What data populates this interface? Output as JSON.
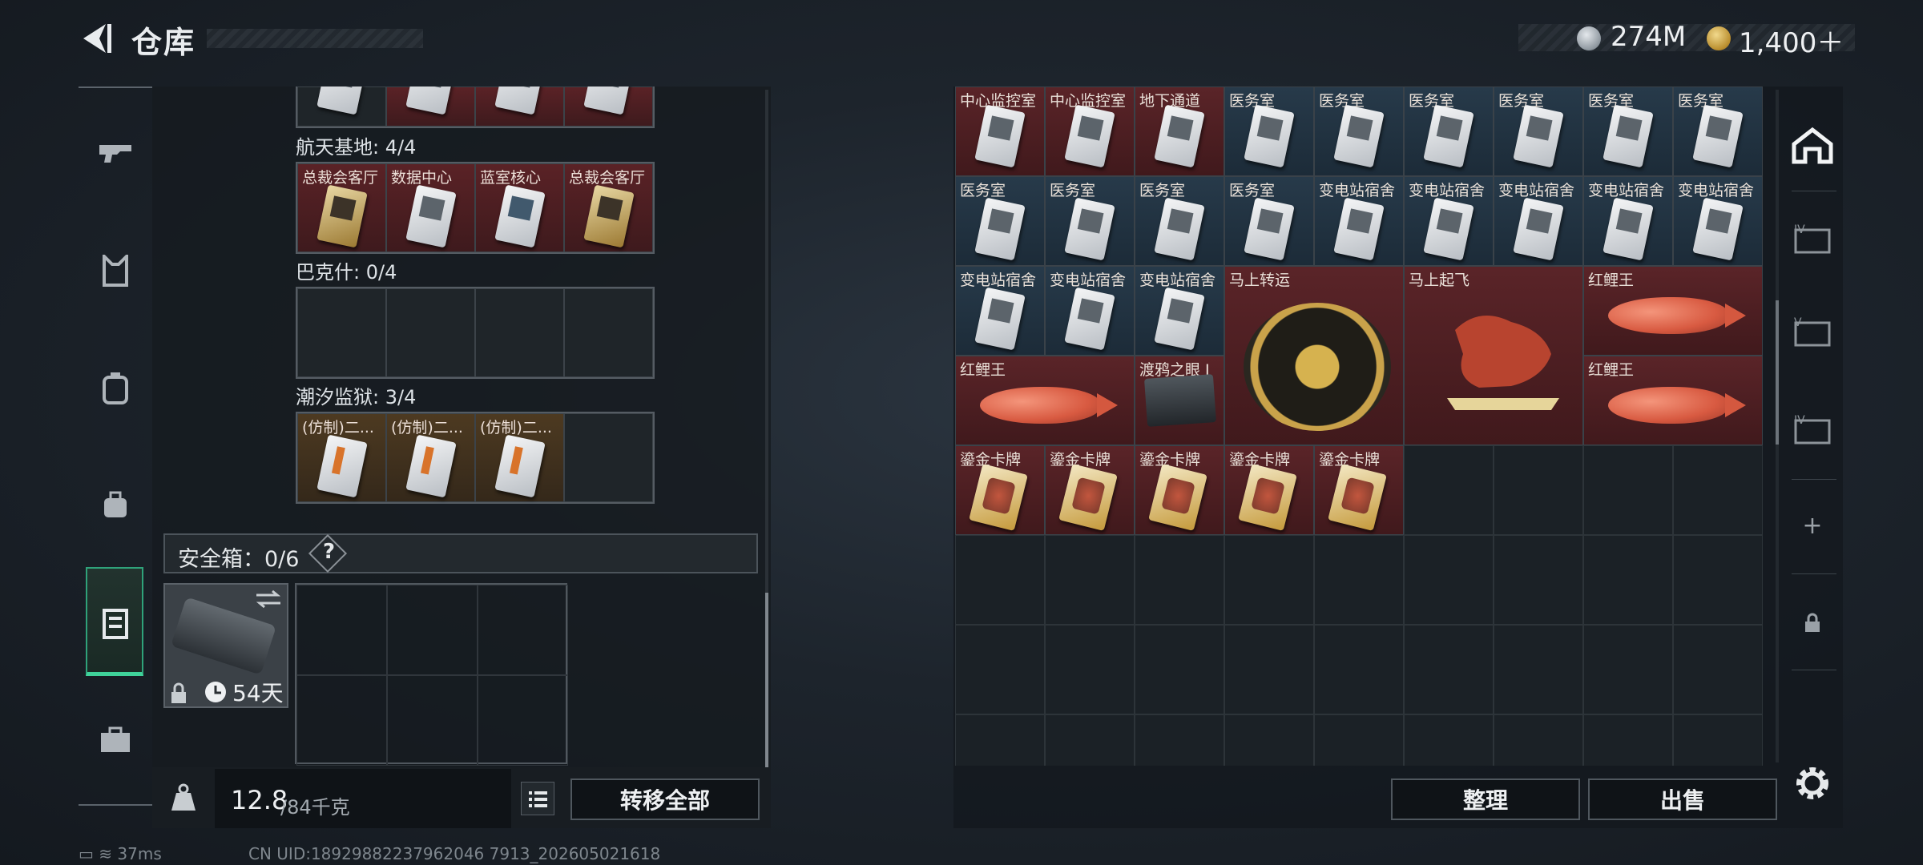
{
  "header": {
    "title": "仓库",
    "silver_value": "274M",
    "gold_value": "1,400＋"
  },
  "left_panel": {
    "groups": [
      {
        "label": "航天基地: 4/4",
        "slots": [
          {
            "label": "总裁会客厅",
            "style": "red",
            "card": "gold"
          },
          {
            "label": "数据中心",
            "style": "red",
            "card": "white"
          },
          {
            "label": "蓝室核心",
            "style": "red",
            "card": "blue"
          },
          {
            "label": "总裁会客厅",
            "style": "red",
            "card": "gold"
          }
        ]
      },
      {
        "label": "巴克什: 0/4",
        "slots": []
      },
      {
        "label": "潮汐监狱: 3/4",
        "slots": [
          {
            "label": "(仿制)二...",
            "style": "gold",
            "card": "orange"
          },
          {
            "label": "(仿制)二...",
            "style": "gold",
            "card": "orange"
          },
          {
            "label": "(仿制)二...",
            "style": "gold",
            "card": "orange"
          }
        ]
      }
    ],
    "safe_box": {
      "label": "安全箱：0/6",
      "help": "?",
      "days": "54天"
    },
    "weight": {
      "current": "12.8",
      "max": "/84千克"
    },
    "transfer_all": "转移全部"
  },
  "right_panel": {
    "rows": [
      [
        "中心监控室",
        "中心监控室",
        "地下通道",
        "医务室",
        "医务室",
        "医务室",
        "医务室",
        "医务室",
        "医务室"
      ],
      [
        "医务室",
        "医务室",
        "医务室",
        "医务室",
        "变电站宿舍",
        "变电站宿舍",
        "变电站宿舍",
        "变电站宿舍",
        "变电站宿舍"
      ],
      [
        "变电站宿舍",
        "变电站宿舍",
        "变电站宿舍"
      ]
    ],
    "big_items": {
      "wheel": "马上转运",
      "horse": "马上起飞",
      "fish1": "红鲤王",
      "fish2": "红鲤王",
      "fish3": "红鲤王",
      "box": "渡鸦之眼 I"
    },
    "gold_cards": [
      "鎏金卡牌",
      "鎏金卡牌",
      "鎏金卡牌",
      "鎏金卡牌",
      "鎏金卡牌"
    ],
    "sort": "整理",
    "sell": "出售"
  },
  "right_rail": {
    "plus": "+"
  },
  "status": {
    "ping": "37ms",
    "uid": "CN UID:18929882237962046 7913_202605021618"
  }
}
